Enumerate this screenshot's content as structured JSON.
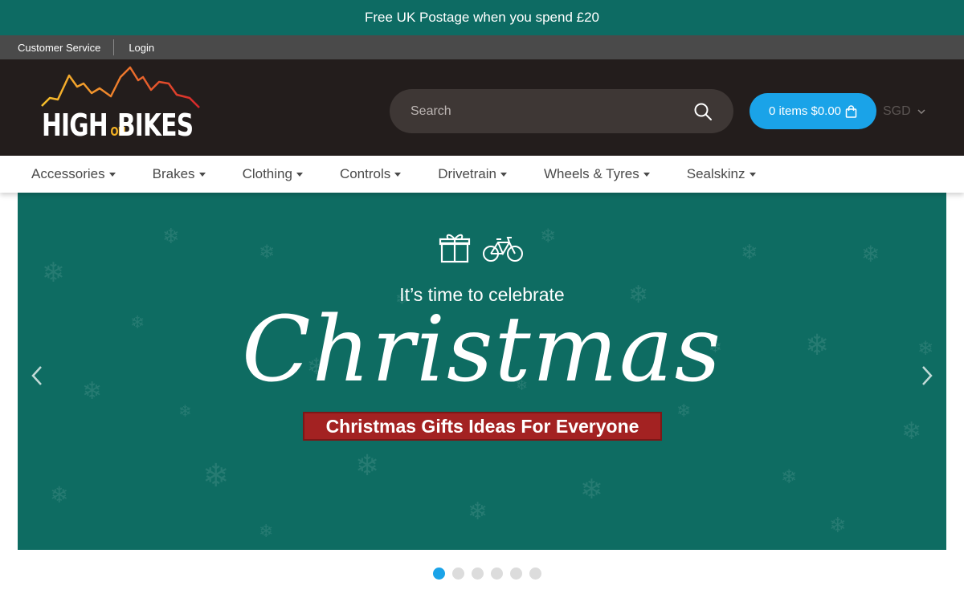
{
  "promo": {
    "text": "Free UK Postage when you spend £20"
  },
  "util": {
    "customer_service": "Customer Service",
    "login": "Login"
  },
  "logo": {
    "word1": "HIGH",
    "word2": "ON",
    "word3": "BIKES"
  },
  "search": {
    "placeholder": "Search",
    "icon": "search-icon"
  },
  "cart": {
    "label": "0 items $0.00",
    "icon": "shopping-bag-icon"
  },
  "currency": {
    "value": "SGD"
  },
  "nav": {
    "items": [
      {
        "label": "Accessories"
      },
      {
        "label": "Brakes"
      },
      {
        "label": "Clothing"
      },
      {
        "label": "Controls"
      },
      {
        "label": "Drivetrain"
      },
      {
        "label": "Wheels & Tyres"
      },
      {
        "label": "Sealskinz"
      }
    ]
  },
  "hero": {
    "subtitle": "It’s time to celebrate",
    "headline": "Christmas",
    "ribbon": "Christmas Gifts Ideas For Everyone",
    "icons": [
      "gift-icon",
      "bicycle-icon"
    ]
  },
  "slider": {
    "dot_count": 6,
    "active_index": 0
  },
  "colors": {
    "promo_bg": "#0d6b63",
    "header_bg": "#231d1c",
    "accent": "#1aa3e8",
    "hero_bg": "#0e6c62",
    "ribbon": "#a32222"
  }
}
